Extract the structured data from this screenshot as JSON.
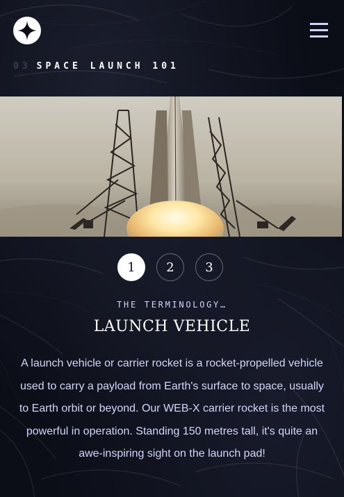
{
  "header": {
    "logo_icon": "star-logo-icon",
    "menu_icon": "hamburger-menu-icon"
  },
  "page": {
    "number": "03",
    "title": "SPACE LAUNCH 101"
  },
  "hero": {
    "image": "rocket-launch-photo"
  },
  "steps": [
    {
      "label": "1",
      "active": true
    },
    {
      "label": "2",
      "active": false
    },
    {
      "label": "3",
      "active": false
    }
  ],
  "content": {
    "eyebrow": "THE TERMINOLOGY…",
    "title": "LAUNCH VEHICLE",
    "description": "A launch vehicle or carrier rocket is a rocket-propelled vehicle used to carry a payload from Earth's surface to space, usually to Earth orbit or beyond. Our WEB-X carrier rocket is the most powerful in operation. Standing 150 metres tall, it's quite an awe-inspiring sight on the launch pad!"
  },
  "colors": {
    "background": "#0b0d17",
    "accent": "#d0d6f9",
    "white": "#ffffff"
  }
}
